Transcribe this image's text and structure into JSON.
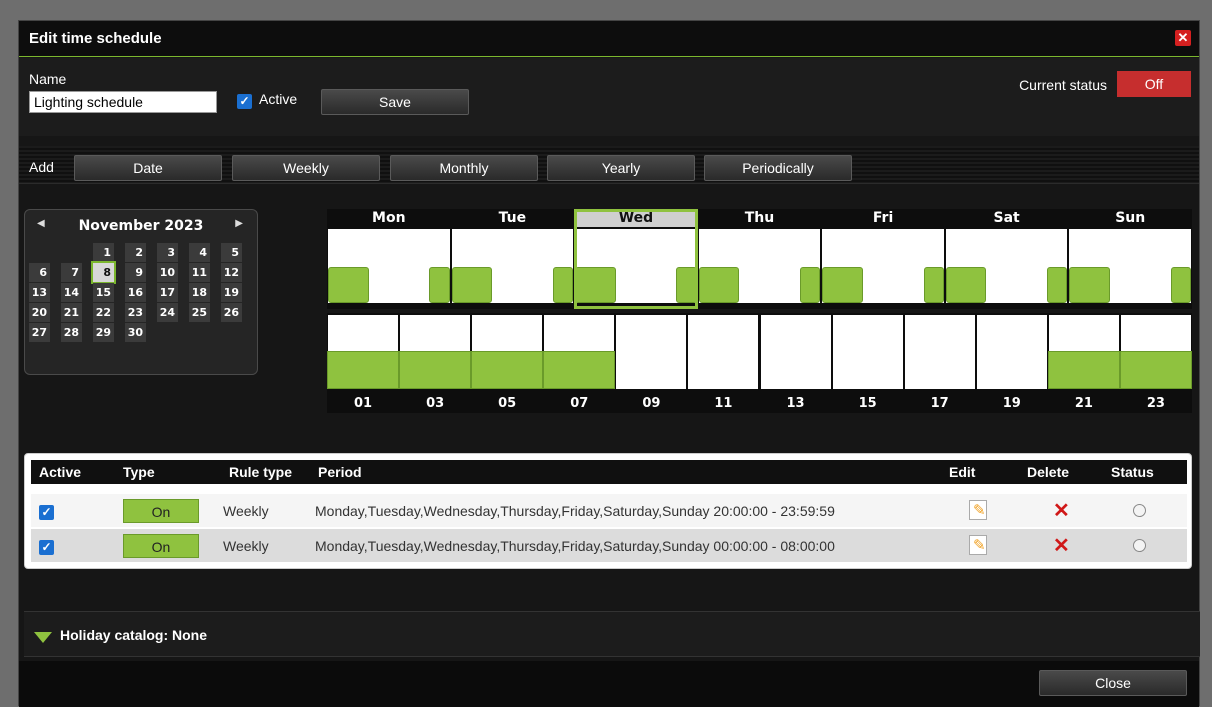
{
  "dialog": {
    "title": "Edit time schedule",
    "close_icon": "close-icon"
  },
  "name_section": {
    "name_label": "Name",
    "name_value": "Lighting schedule",
    "active_label": "Active",
    "active_checked": true,
    "save_label": "Save",
    "current_status_label": "Current status",
    "current_status_value": "Off",
    "status_color": "#c62e2e"
  },
  "add_section": {
    "label": "Add",
    "buttons": [
      "Date",
      "Weekly",
      "Monthly",
      "Yearly",
      "Periodically"
    ]
  },
  "calendar": {
    "month": "November 2023",
    "selected_day": 8,
    "rows": [
      [
        "",
        "",
        "1",
        "2",
        "3",
        "4",
        "5"
      ],
      [
        "6",
        "7",
        "8",
        "9",
        "10",
        "11",
        "12"
      ],
      [
        "13",
        "14",
        "15",
        "16",
        "17",
        "18",
        "19"
      ],
      [
        "20",
        "21",
        "22",
        "23",
        "24",
        "25",
        "26"
      ],
      [
        "27",
        "28",
        "29",
        "30",
        "",
        "",
        ""
      ]
    ]
  },
  "week_schedule": {
    "days": [
      "Mon",
      "Tue",
      "Wed",
      "Thu",
      "Fri",
      "Sat",
      "Sun"
    ],
    "selected_day": "Wed",
    "on_color": "#8fc23f"
  },
  "day_schedule": {
    "hour_labels": [
      "01",
      "03",
      "05",
      "07",
      "09",
      "11",
      "13",
      "15",
      "17",
      "19",
      "21",
      "23"
    ],
    "on_until_hour": 8,
    "on_from_hour": 20
  },
  "rules": {
    "headers": {
      "active": "Active",
      "type": "Type",
      "rule_type": "Rule type",
      "period": "Period",
      "edit": "Edit",
      "delete": "Delete",
      "status": "Status"
    },
    "rows": [
      {
        "active": true,
        "type": "On",
        "rule_type": "Weekly",
        "period": "Monday,Tuesday,Wednesday,Thursday,Friday,Saturday,Sunday 20:00:00 - 23:59:59"
      },
      {
        "active": true,
        "type": "On",
        "rule_type": "Weekly",
        "period": "Monday,Tuesday,Wednesday,Thursday,Friday,Saturday,Sunday 00:00:00 - 08:00:00"
      }
    ]
  },
  "holiday": {
    "label": "Holiday catalog: None"
  },
  "footer": {
    "close_label": "Close"
  }
}
